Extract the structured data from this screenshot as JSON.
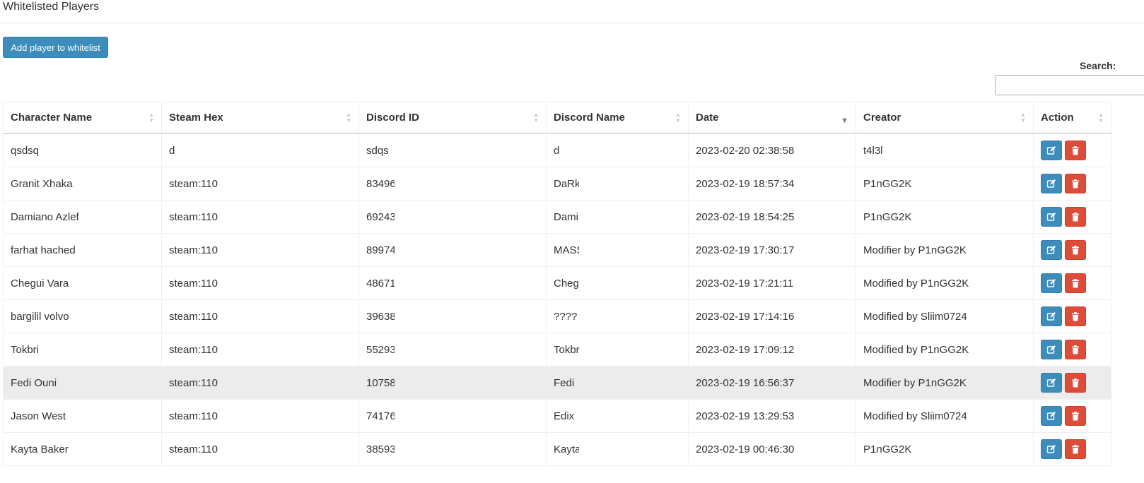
{
  "page": {
    "title": "Whitelisted Players"
  },
  "toolbar": {
    "add_label": "Add player to whitelist"
  },
  "search": {
    "label": "Search:",
    "placeholder": ""
  },
  "table": {
    "columns": [
      "Character Name",
      "Steam Hex",
      "Discord ID",
      "Discord Name",
      "Date",
      "Creator",
      "Action"
    ],
    "sorted_column": "Date",
    "sort_direction": "desc",
    "rows": [
      {
        "character_name": "qsdsq",
        "steam_hex": "d",
        "discord_id": "sdqs",
        "discord_name": "d",
        "date": "2023-02-20 02:38:58",
        "creator": "t4l3l"
      },
      {
        "character_name": "Granit Xhaka",
        "steam_hex": "steam:110",
        "discord_id": "83496",
        "discord_name": "DaRk",
        "date": "2023-02-19 18:57:34",
        "creator": "P1nGG2K"
      },
      {
        "character_name": "Damiano Azlef",
        "steam_hex": "steam:110",
        "discord_id": "69243",
        "discord_name": "Dami",
        "date": "2023-02-19 18:54:25",
        "creator": "P1nGG2K"
      },
      {
        "character_name": "farhat hached",
        "steam_hex": "steam:110",
        "discord_id": "89974",
        "discord_name": "MASS",
        "date": "2023-02-19 17:30:17",
        "creator": "Modifier by P1nGG2K"
      },
      {
        "character_name": "Chegui Vara",
        "steam_hex": "steam:110",
        "discord_id": "48671",
        "discord_name": "Cheg",
        "date": "2023-02-19 17:21:11",
        "creator": "Modified by P1nGG2K"
      },
      {
        "character_name": "bargilil volvo",
        "steam_hex": "steam:110",
        "discord_id": "39638",
        "discord_name": "????",
        "date": "2023-02-19 17:14:16",
        "creator": "Modified by Sliim0724"
      },
      {
        "character_name": "Tokbri",
        "steam_hex": "steam:110",
        "discord_id": "55293",
        "discord_name": "Tokbr",
        "date": "2023-02-19 17:09:12",
        "creator": "Modified by P1nGG2K"
      },
      {
        "character_name": "Fedi Ouni",
        "steam_hex": "steam:110",
        "discord_id": "10758",
        "discord_name": "Fedi",
        "date": "2023-02-19 16:56:37",
        "creator": "Modifier by P1nGG2K"
      },
      {
        "character_name": "Jason West",
        "steam_hex": "steam:110",
        "discord_id": "74176",
        "discord_name": "Edix",
        "date": "2023-02-19 13:29:53",
        "creator": "Modified by Sliim0724"
      },
      {
        "character_name": "Kayta Baker",
        "steam_hex": "steam:110",
        "discord_id": "38593",
        "discord_name": "Kayta",
        "date": "2023-02-19 00:46:30",
        "creator": "P1nGG2K"
      }
    ]
  },
  "icons": {
    "edit": "edit-icon",
    "delete": "trash-icon"
  },
  "colors": {
    "primary": "#3c8dbc",
    "danger": "#dd4b39",
    "hover_row": "#ececec"
  }
}
